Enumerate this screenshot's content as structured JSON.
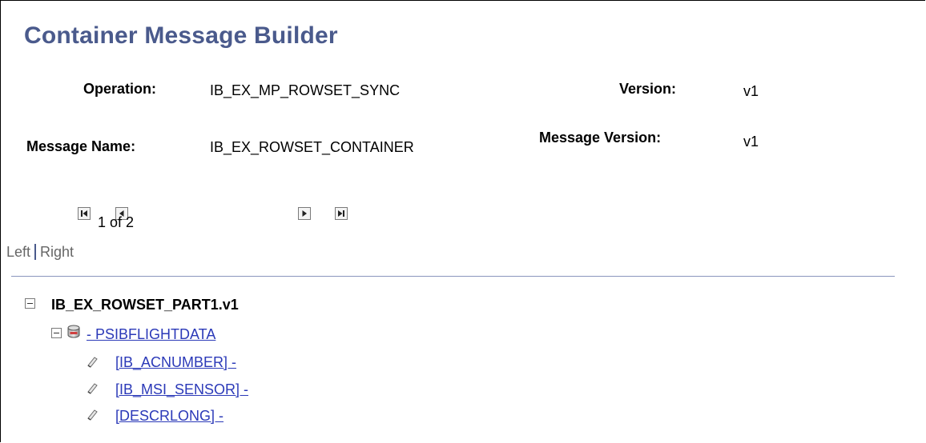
{
  "page": {
    "title": "Container Message Builder"
  },
  "fields": {
    "operation_label": "Operation:",
    "operation_value": "IB_EX_MP_ROWSET_SYNC",
    "version_label": "Version:",
    "version_value": "v1",
    "message_name_label": "Message Name:",
    "message_name_value": "IB_EX_ROWSET_CONTAINER",
    "message_version_label": "Message Version:",
    "message_version_value": "v1"
  },
  "pagination": {
    "count_text": "1 of 2"
  },
  "switch": {
    "left_label": "Left",
    "right_label": "Right"
  },
  "tree": {
    "root_label": "IB_EX_ROWSET_PART1.v1",
    "record_label": "- PSIBFLIGHTDATA",
    "fields": [
      {
        "label": "[IB_ACNUMBER] -"
      },
      {
        "label": "[IB_MSI_SENSOR] -"
      },
      {
        "label": "[DESCRLONG] -"
      }
    ]
  },
  "colors": {
    "title": "#4a5a8c",
    "link": "#2b39b8",
    "divider": "#8a95bd"
  }
}
